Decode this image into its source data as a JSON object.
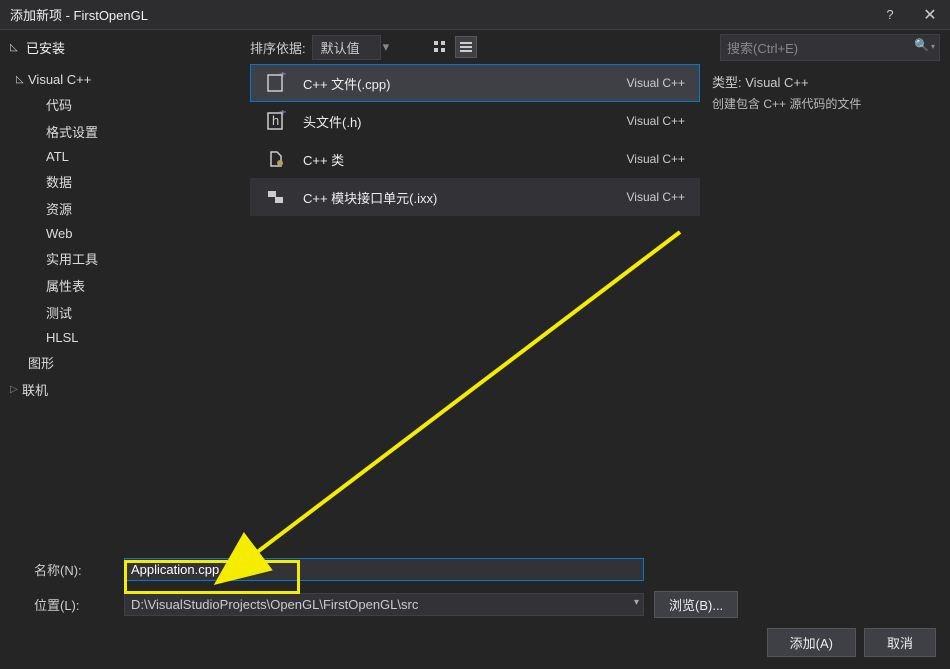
{
  "title": "添加新项 - FirstOpenGL",
  "help_icon": "?",
  "close_icon": "✕",
  "sort_label": "排序依据:",
  "sort_value": "默认值",
  "search_placeholder": "搜索(Ctrl+E)",
  "sidebar": {
    "installed": "已安装",
    "vcpp": "Visual C++",
    "items": [
      "代码",
      "格式设置",
      "ATL",
      "数据",
      "资源",
      "Web",
      "实用工具",
      "属性表",
      "测试",
      "HLSL"
    ],
    "graphics": "图形",
    "online": "联机"
  },
  "templates": [
    {
      "name": "C++ 文件(.cpp)",
      "lang": "Visual C++"
    },
    {
      "name": "头文件(.h)",
      "lang": "Visual C++"
    },
    {
      "name": "C++ 类",
      "lang": "Visual C++"
    },
    {
      "name": "C++ 模块接口单元(.ixx)",
      "lang": "Visual C++"
    }
  ],
  "detail": {
    "type_label": "类型:",
    "type_value": "Visual C++",
    "desc": "创建包含 C++ 源代码的文件"
  },
  "fields": {
    "name_label": "名称(N):",
    "name_value": "Application.cpp",
    "loc_label": "位置(L):",
    "loc_value": "D:\\VisualStudioProjects\\OpenGL\\FirstOpenGL\\src",
    "browse": "浏览(B)..."
  },
  "buttons": {
    "add": "添加(A)",
    "cancel": "取消"
  }
}
